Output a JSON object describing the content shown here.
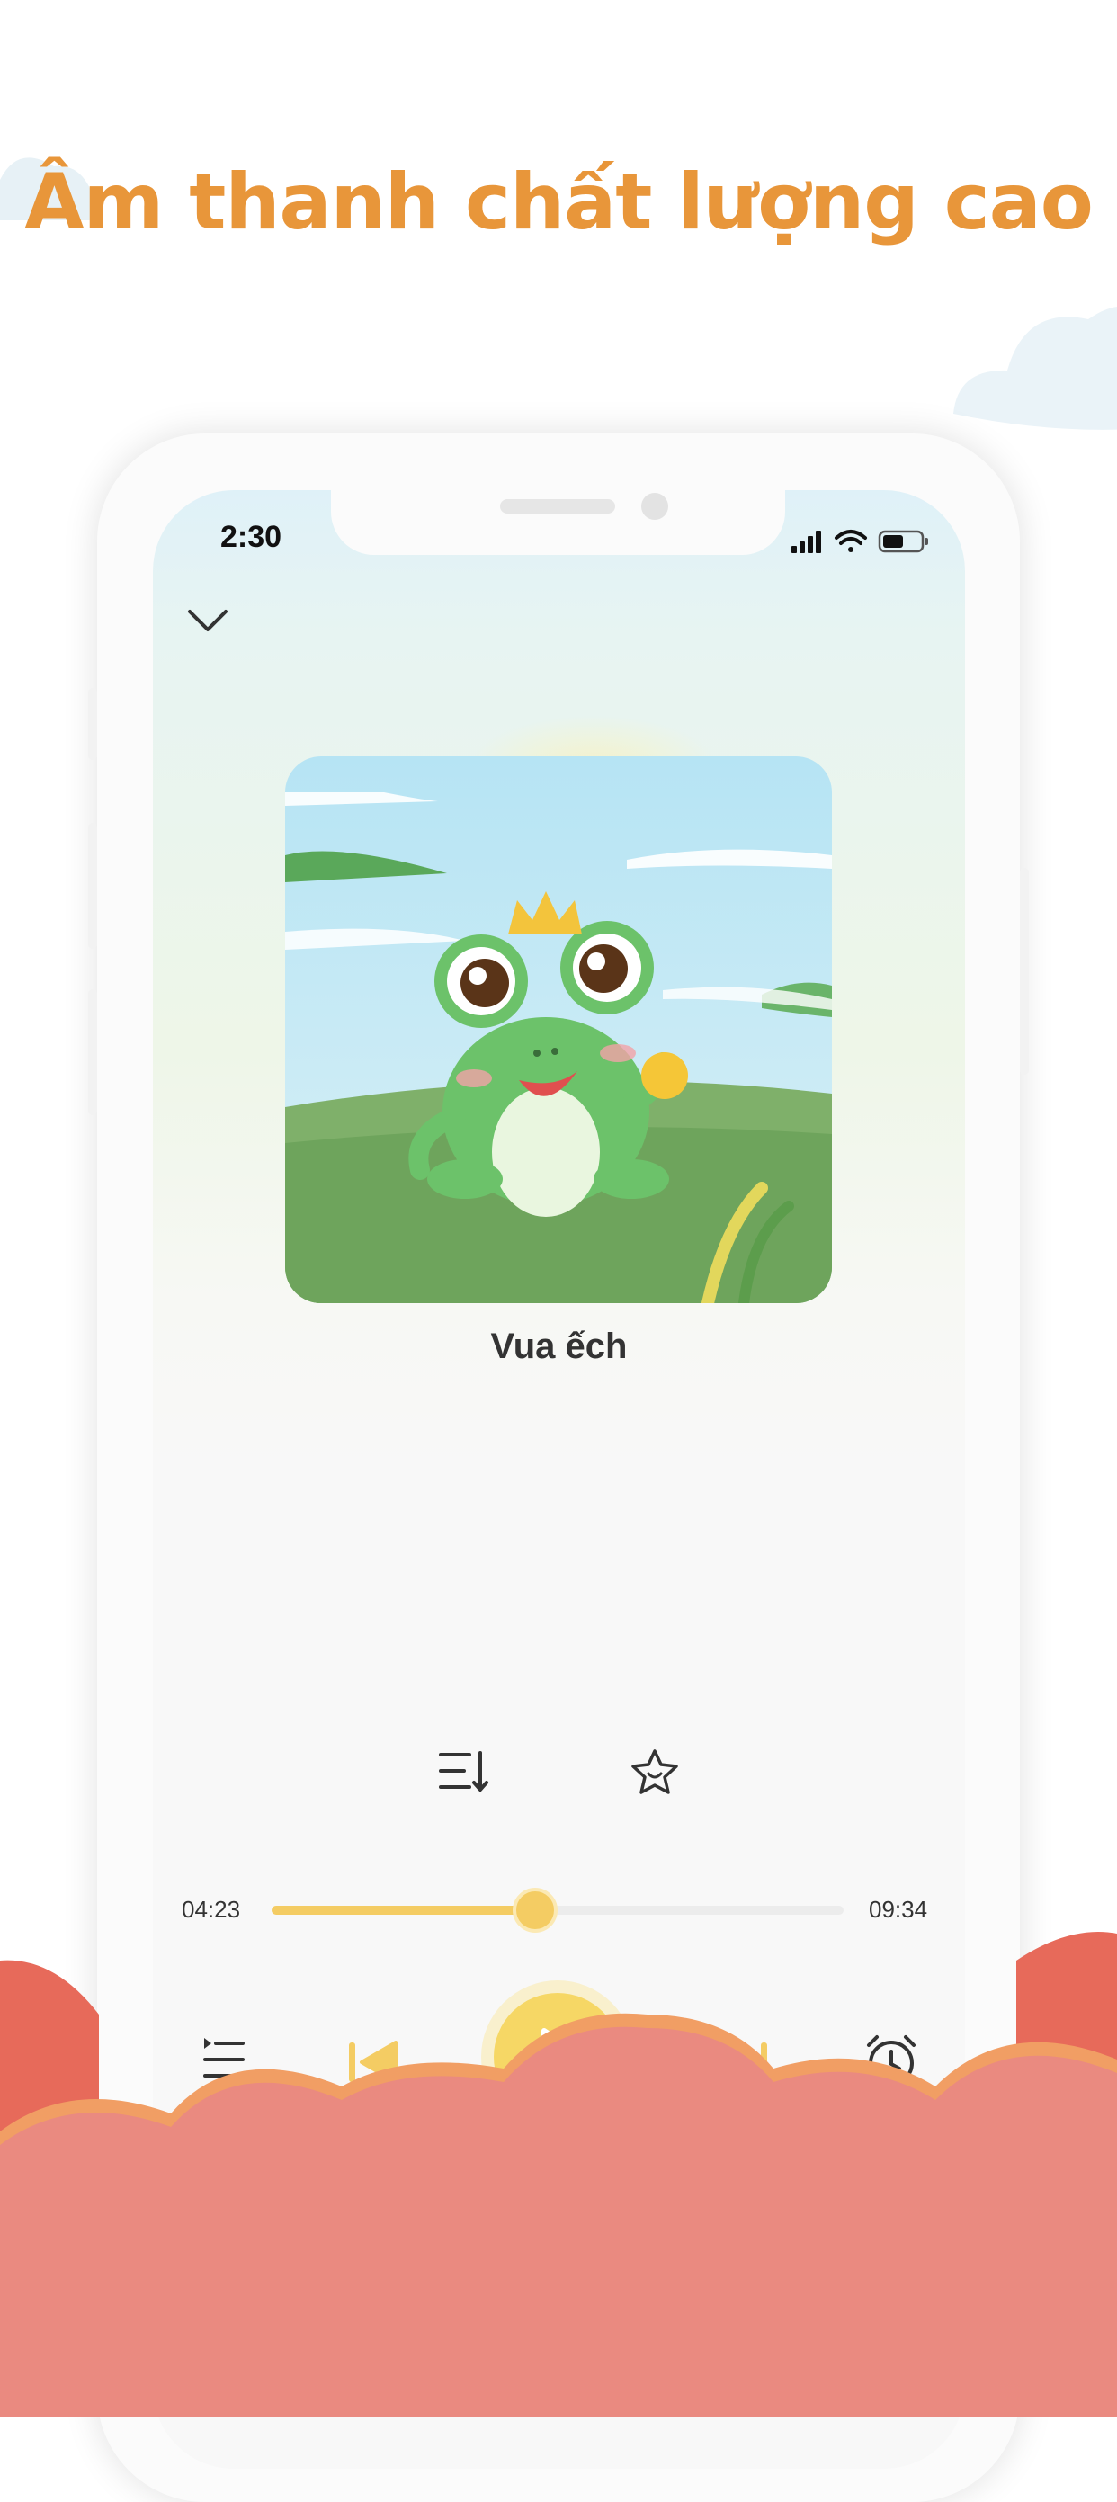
{
  "headline": "Âm thanh chất lượng cao",
  "status_bar": {
    "time": "2:30"
  },
  "player": {
    "track_title": "Vua ếch",
    "time_current": "04:23",
    "time_total": "09:34",
    "progress": 0.46
  },
  "icons": {
    "collapse": "chevron-down-icon",
    "sort_playlist": "sort-list-icon",
    "favorite": "star-icon",
    "queue": "queue-list-icon",
    "previous": "skip-previous-icon",
    "play": "play-icon",
    "next": "skip-next-icon",
    "timer": "alarm-clock-icon"
  },
  "colors": {
    "headline": "#e8963a",
    "accent": "#f6d765",
    "cloud_top": "#f08a6e",
    "cloud_bottom": "#e8847f"
  }
}
